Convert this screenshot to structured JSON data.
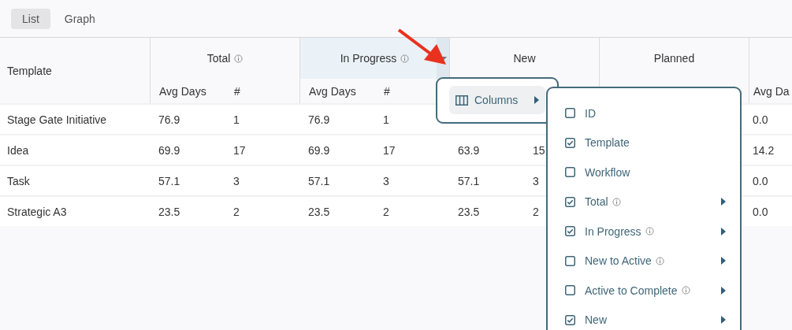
{
  "view_tabs": [
    {
      "label": "List",
      "selected": true
    },
    {
      "label": "Graph",
      "selected": false
    }
  ],
  "table": {
    "template_header": "Template",
    "groups": [
      {
        "label": "Total",
        "info": true,
        "highlighted": false,
        "caret": false,
        "subheaders": [
          "Avg Days",
          "#"
        ]
      },
      {
        "label": "In Progress",
        "info": true,
        "highlighted": true,
        "caret": true,
        "subheaders": [
          "Avg Days",
          "#"
        ]
      },
      {
        "label": "New",
        "info": false,
        "highlighted": false,
        "caret": false
      },
      {
        "label": "Planned",
        "info": false,
        "highlighted": false,
        "caret": false
      },
      {
        "subheaders": [
          "Avg Da"
        ]
      }
    ],
    "rows": [
      {
        "template": "Stage Gate Initiative",
        "total": [
          "76.9",
          "1"
        ],
        "in_progress": [
          "76.9",
          "1"
        ],
        "column_5": [
          "0.0"
        ]
      },
      {
        "template": "Idea",
        "total": [
          "69.9",
          "17"
        ],
        "in_progress": [
          "69.9",
          "17"
        ],
        "new": [
          "63.9",
          "15"
        ],
        "column_5": [
          "14.2"
        ]
      },
      {
        "template": "Task",
        "total": [
          "57.1",
          "3"
        ],
        "in_progress": [
          "57.1",
          "3"
        ],
        "new": [
          "57.1",
          "3"
        ],
        "column_5": [
          "0.0"
        ]
      },
      {
        "template": "Strategic A3",
        "total": [
          "23.5",
          "2"
        ],
        "in_progress": [
          "23.5",
          "2"
        ],
        "new": [
          "23.5",
          "2"
        ],
        "column_5": [
          "0.0"
        ]
      }
    ]
  },
  "column_menu": {
    "items": [
      {
        "label": "Columns",
        "submenu": true
      }
    ]
  },
  "columns_submenu": {
    "items": [
      {
        "label": "ID",
        "checked": false,
        "info": false,
        "submenu": false
      },
      {
        "label": "Template",
        "checked": true,
        "info": false,
        "submenu": false
      },
      {
        "label": "Workflow",
        "checked": false,
        "info": false,
        "submenu": false
      },
      {
        "label": "Total",
        "checked": true,
        "info": true,
        "submenu": true
      },
      {
        "label": "In Progress",
        "checked": true,
        "info": true,
        "submenu": true
      },
      {
        "label": "New to Active",
        "checked": false,
        "info": true,
        "submenu": true
      },
      {
        "label": "Active to Complete",
        "checked": false,
        "info": true,
        "submenu": true
      },
      {
        "label": "New",
        "checked": true,
        "info": false,
        "submenu": true
      }
    ]
  }
}
